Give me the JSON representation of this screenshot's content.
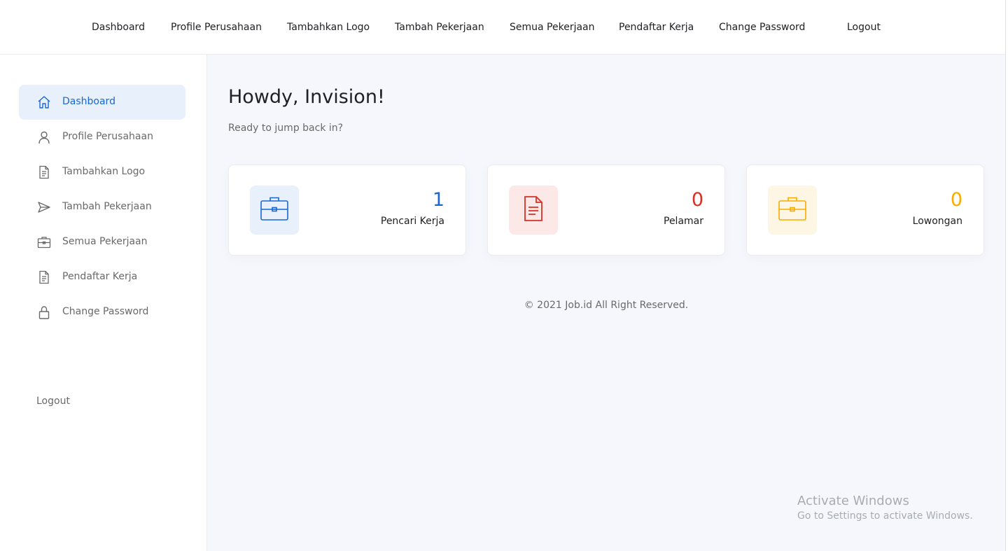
{
  "topnav": {
    "items": [
      "Dashboard",
      "Profile Perusahaan",
      "Tambahkan Logo",
      "Tambah Pekerjaan",
      "Semua Pekerjaan",
      "Pendaftar Kerja",
      "Change Password"
    ],
    "logout": "Logout"
  },
  "sidebar": {
    "items": [
      {
        "label": "Dashboard",
        "icon": "home-icon",
        "active": true
      },
      {
        "label": "Profile Perusahaan",
        "icon": "user-icon"
      },
      {
        "label": "Tambahkan Logo",
        "icon": "document-icon"
      },
      {
        "label": "Tambah Pekerjaan",
        "icon": "send-icon"
      },
      {
        "label": "Semua Pekerjaan",
        "icon": "briefcase-icon"
      },
      {
        "label": "Pendaftar Kerja",
        "icon": "document-icon"
      },
      {
        "label": "Change Password",
        "icon": "lock-icon"
      }
    ],
    "logout": "Logout",
    "accent": "#1967d2"
  },
  "main": {
    "title": "Howdy, Invision!",
    "subtitle": "Ready to jump back in?"
  },
  "cards": [
    {
      "value": "1",
      "label": "Pencari Kerja",
      "color": "#1967d2",
      "bg": "#e7f0fb",
      "icon": "briefcase-icon"
    },
    {
      "value": "0",
      "label": "Pelamar",
      "color": "#d93025",
      "bg": "#fce8e6",
      "icon": "document-icon"
    },
    {
      "value": "0",
      "label": "Lowongan",
      "color": "#f9ab00",
      "bg": "#fef6e5",
      "icon": "briefcase-icon"
    }
  ],
  "footer": "© 2021 Job.id All Right Reserved.",
  "watermark": {
    "line1": "Activate Windows",
    "line2": "Go to Settings to activate Windows."
  }
}
